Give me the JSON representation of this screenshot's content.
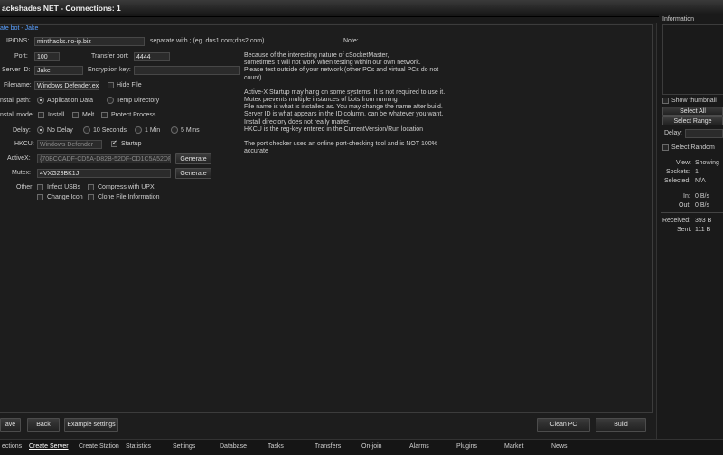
{
  "window": {
    "title": "ackshades NET - Connections: 1"
  },
  "group": {
    "label": "ate bot - Jake"
  },
  "form": {
    "ipdns_label": "IP/DNS:",
    "ipdns_value": "minthacks.no-ip.biz",
    "separate_hint": "separate with ; (eg. dns1.com;dns2.com)",
    "note_label": "Note:",
    "port_label": "Port:",
    "port_value": "100",
    "transfer_port_label": "Transfer port:",
    "transfer_port_value": "4444",
    "server_id_label": "Server ID:",
    "server_id_value": "Jake",
    "encryption_label": "Encryption key:",
    "encryption_value": "",
    "filename_label": "Filename:",
    "filename_value": "Windows Defender.ex",
    "hide_file_label": "Hide File",
    "install_path_label": "nstall path:",
    "app_data_label": "Application Data",
    "temp_dir_label": "Temp Directory",
    "install_mode_label": "nstall mode:",
    "install_label": "Install",
    "melt_label": "Melt",
    "protect_label": "Protect Process",
    "delay_label": "Delay:",
    "no_delay_label": "No Delay",
    "ten_sec_label": "10 Seconds",
    "one_min_label": "1 Min",
    "five_min_label": "5 Mins",
    "hkcu_label": "HKCU:",
    "hkcu_value": "Windows Defender",
    "startup_label": "Startup",
    "activex_label": "ActiveX:",
    "activex_value": "{70BCCADF-CD5A-D82B-52DF-CD1C5A52DF",
    "mutex_label": "Mutex:",
    "mutex_value": "4VXG23BK1J",
    "generate_label": "Generate",
    "other_label": "Other:",
    "infect_usb_label": "Infect USBs",
    "compress_upx_label": "Compress with UPX",
    "change_icon_label": "Change Icon",
    "clone_info_label": "Clone File Information"
  },
  "notes": [
    "Because of the interesting nature of cSocketMaster,",
    "sometimes it will not work when testing within our own network.",
    "Please test outside of your network (other PCs and virtual PCs do not",
    "count).",
    "",
    "Active-X Startup may hang on some systems. It is not required to use it.",
    "Mutex prevents multiple instances of bots from running",
    "File name is what is installed as. You may change the name after build.",
    "Server ID is what appears in the ID column, can be whatever you want.",
    "Install directory does not really matter.",
    "HKCU is the reg-key entered in the CurrentVersion/Run location",
    "",
    "The port checker uses an online port-checking tool and is NOT 100%",
    "accurate"
  ],
  "buttons": {
    "save": "ave",
    "back": "Back",
    "example": "Example settings",
    "clean_pc": "Clean PC",
    "build": "Build"
  },
  "sidebar": {
    "information_label": "Information",
    "show_thumbnail": "Show thumbnail",
    "select_all": "Select All",
    "select_range": "Select Range",
    "delay_label": "Delay:",
    "select_random": "Select Random",
    "view_label": "View:",
    "view_value": "Showing",
    "sockets_label": "Sockets:",
    "sockets_value": "1",
    "selected_label": "Selected:",
    "selected_value": "N/A",
    "in_label": "In:",
    "in_value": "0 B/s",
    "out_label": "Out:",
    "out_value": "0 B/s",
    "received_label": "Received:",
    "received_value": "393 B",
    "sent_label": "Sent:",
    "sent_value": "111 B"
  },
  "tabs": [
    "ections",
    "Create Server",
    "Create Station",
    "Statistics",
    "Settings",
    "Database",
    "Tasks",
    "Transfers",
    "On-join",
    "Alarms",
    "Plugins",
    "Market",
    "News"
  ]
}
